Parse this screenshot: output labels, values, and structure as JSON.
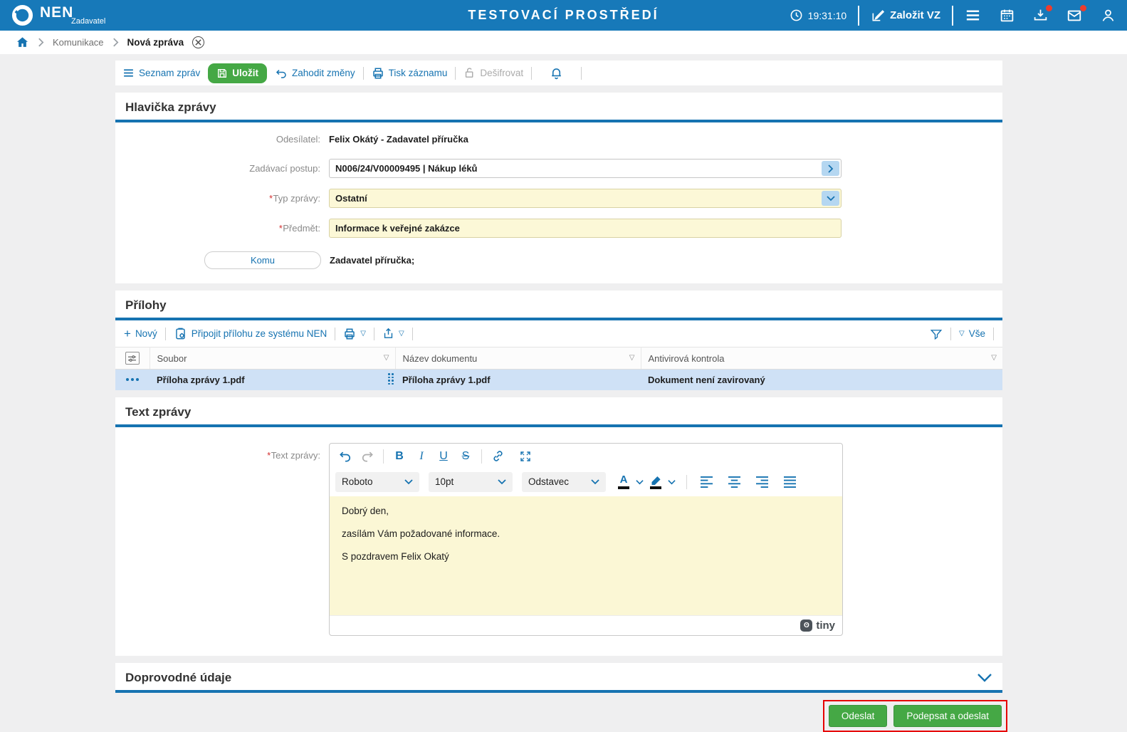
{
  "colors": {
    "header_blue": "#1779b9",
    "link_blue": "#1673b1",
    "button_green": "#45a845",
    "field_yellow": "#fcf8d7",
    "selected_row_blue": "#cfe1f6",
    "badge_red": "#ee3c2d",
    "highlight_outline_red": "#e60000"
  },
  "icons": {
    "required_mark": "*",
    "plus": "+",
    "filter_caret": "▽",
    "close_x": "×"
  },
  "topbar": {
    "brand": "NEN",
    "brand_sub": "Zadavatel",
    "env_title": "TESTOVACÍ PROSTŘEDÍ",
    "time": "19:31:10",
    "create_vz": "Založit VZ"
  },
  "breadcrumb": {
    "level1": "Komunikace",
    "level2": "Nová zpráva"
  },
  "toolbar": {
    "list": "Seznam zpráv",
    "save": "Uložit",
    "discard": "Zahodit změny",
    "print": "Tisk záznamu",
    "decrypt": "Dešifrovat"
  },
  "message_header": {
    "section_title": "Hlavička zprávy",
    "sender_label": "Odesílatel:",
    "sender_value": "Felix Okátý - Zadavatel příručka",
    "procedure_label": "Zadávací postup:",
    "procedure_value": "N006/24/V00009495 | Nákup léků",
    "type_label": "Typ zprávy:",
    "type_value": "Ostatní",
    "subject_label": "Předmět:",
    "subject_value": "Informace k veřejné zakázce",
    "to_button": "Komu",
    "to_value": "Zadavatel příručka;"
  },
  "attachments": {
    "section_title": "Přílohy",
    "new_label": "Nový",
    "attach_label": "Připojit přílohu ze systému NEN",
    "all_label": "Vše",
    "columns": [
      "Soubor",
      "Název dokumentu",
      "Antivirová kontrola"
    ],
    "rows": [
      {
        "file": "Příloha zprávy 1.pdf",
        "doc_name": "Příloha zprávy 1.pdf",
        "antivirus": "Dokument není zavirovaný"
      }
    ]
  },
  "message_body": {
    "section_title": "Text zprávy",
    "field_label": "Text zprávy:",
    "editor": {
      "font": "Roboto",
      "font_size": "10pt",
      "block": "Odstavec",
      "brand": "tiny"
    },
    "paragraphs": [
      "Dobrý den,",
      "zasílám Vám požadované informace.",
      "S pozdravem Felix Okatý"
    ]
  },
  "accompanying": {
    "section_title": "Doprovodné údaje"
  },
  "actions": {
    "send": "Odeslat",
    "sign_send": "Podepsat a odeslat"
  }
}
